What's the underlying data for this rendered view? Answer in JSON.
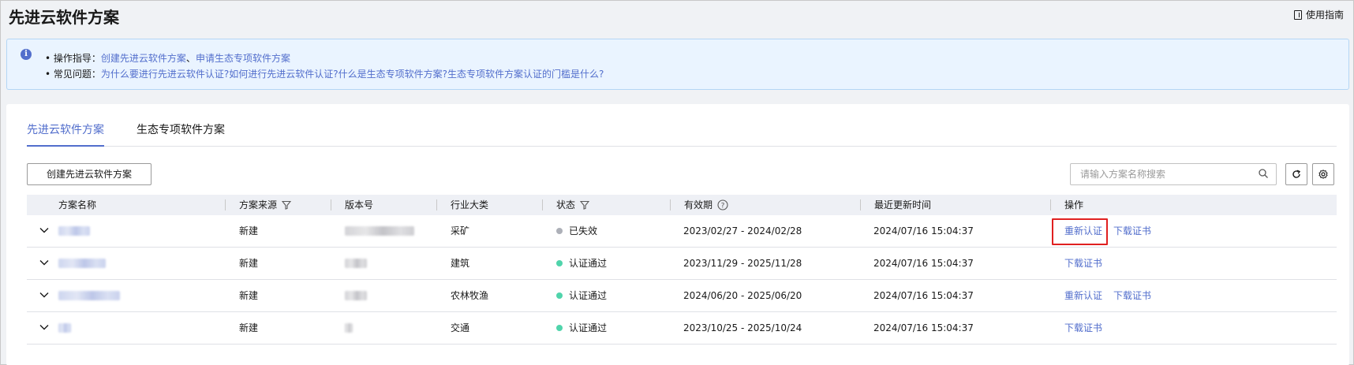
{
  "page": {
    "title": "先进云软件方案",
    "guide_label": "使用指南"
  },
  "info": {
    "line1_prefix": "• 操作指导：",
    "line1_links": [
      "创建先进云软件方案",
      "申请生态专项软件方案"
    ],
    "line1_sep": "、",
    "line2_prefix": "• 常见问题：",
    "line2_links": [
      "为什么要进行先进云软件认证?",
      "如何进行先进云软件认证?",
      "什么是生态专项软件方案?",
      "生态专项软件方案认证的门槛是什么?"
    ]
  },
  "tabs": [
    {
      "label": "先进云软件方案",
      "active": true
    },
    {
      "label": "生态专项软件方案",
      "active": false
    }
  ],
  "toolbar": {
    "create_label": "创建先进云软件方案",
    "search_placeholder": "请输入方案名称搜索"
  },
  "table": {
    "columns": [
      "方案名称",
      "方案来源",
      "版本号",
      "行业大类",
      "状态",
      "有效期",
      "最近更新时间",
      "操作"
    ],
    "rows": [
      {
        "source": "新建",
        "industry": "采矿",
        "status": "已失效",
        "status_color": "#adb0b8",
        "validity": "2023/02/27 - 2024/02/28",
        "updated": "2024/07/16 15:04:37",
        "actions": [
          "重新认证",
          "下载证书"
        ]
      },
      {
        "source": "新建",
        "industry": "建筑",
        "status": "认证通过",
        "status_color": "#50d4ab",
        "validity": "2023/11/29 - 2025/11/28",
        "updated": "2024/07/16 15:04:37",
        "actions": [
          "下载证书"
        ]
      },
      {
        "source": "新建",
        "industry": "农林牧渔",
        "status": "认证通过",
        "status_color": "#50d4ab",
        "validity": "2024/06/20 - 2025/06/20",
        "updated": "2024/07/16 15:04:37",
        "actions": [
          "重新认证",
          "下载证书"
        ]
      },
      {
        "source": "新建",
        "industry": "交通",
        "status": "认证通过",
        "status_color": "#50d4ab",
        "validity": "2023/10/25 - 2025/10/24",
        "updated": "2024/07/16 15:04:37",
        "actions": [
          "下载证书"
        ]
      }
    ]
  },
  "colors": {
    "accent": "#526ecc",
    "highlight": "#e02020"
  }
}
